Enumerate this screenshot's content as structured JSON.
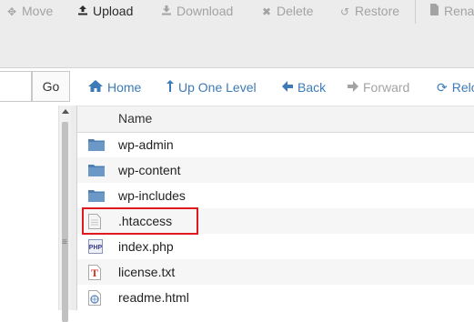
{
  "toolbar": {
    "move_label": "Move",
    "upload_label": "Upload",
    "download_label": "Download",
    "delete_label": "Delete",
    "restore_label": "Restore",
    "rename_label": "Rena"
  },
  "navbar": {
    "go_label": "Go",
    "home_label": "Home",
    "up_label": "Up One Level",
    "back_label": "Back",
    "forward_label": "Forward",
    "reload_label": "Relo"
  },
  "file_list": {
    "header_name": "Name",
    "rows": [
      {
        "name": "wp-admin",
        "icon": "folder-icon"
      },
      {
        "name": "wp-content",
        "icon": "folder-icon"
      },
      {
        "name": "wp-includes",
        "icon": "folder-icon"
      },
      {
        "name": ".htaccess",
        "icon": "text-file-icon"
      },
      {
        "name": "index.php",
        "icon": "php-file-icon"
      },
      {
        "name": "license.txt",
        "icon": "txt-file-icon"
      },
      {
        "name": "readme.html",
        "icon": "html-file-icon"
      }
    ]
  },
  "colors": {
    "accent_link": "#3d7ab8",
    "disabled": "#a3a3a3",
    "highlight": "#e0191f",
    "folder": "#5b87b8"
  }
}
